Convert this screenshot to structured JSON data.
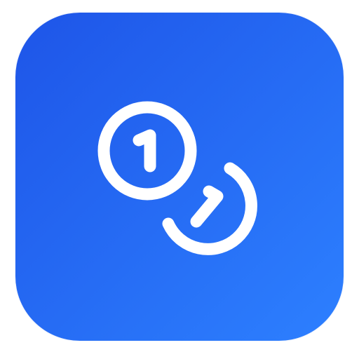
{
  "app_icon": {
    "icon": "coins-icon",
    "colors": {
      "gradient_start": "#1E55E8",
      "gradient_end": "#2D80FF",
      "glyph": "#FFFFFF",
      "page_background": "#FFFFFF"
    },
    "coins": [
      {
        "name": "front-coin",
        "digit": "1"
      },
      {
        "name": "back-coin",
        "digit": "1"
      }
    ]
  }
}
